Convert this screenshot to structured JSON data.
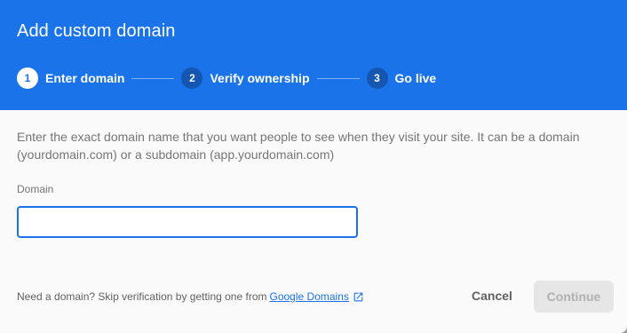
{
  "dialog": {
    "title": "Add custom domain",
    "steps": [
      {
        "number": "1",
        "label": "Enter domain",
        "state": "active"
      },
      {
        "number": "2",
        "label": "Verify ownership",
        "state": "inactive"
      },
      {
        "number": "3",
        "label": "Go live",
        "state": "inactive"
      }
    ],
    "description": "Enter the exact domain name that you want people to see when they visit your site. It can be a domain (yourdomain.com) or a subdomain (app.yourdomain.com)",
    "domain_field": {
      "label": "Domain",
      "value": ""
    },
    "footer": {
      "note": "Need a domain? Skip verification by getting one from",
      "link_label": "Google Domains",
      "link_icon": "open-in-new-icon"
    },
    "buttons": {
      "cancel_label": "Cancel",
      "continue_label": "Continue",
      "continue_disabled": true
    }
  },
  "colors": {
    "header": "#1a73e8",
    "accent": "#1a73e8",
    "background": "#fafafa"
  }
}
